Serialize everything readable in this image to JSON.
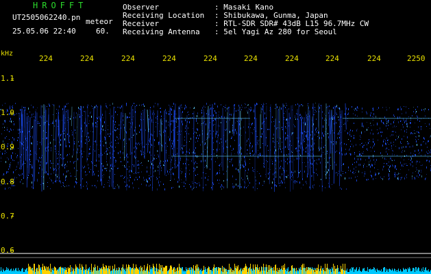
{
  "header": {
    "app_title": "HROFFT",
    "file_name": "UT2505062240.pn",
    "file_tag": "meteor",
    "timestamp": "25.05.06 22:40",
    "rate": "60."
  },
  "station": {
    "observer_label": "Observer",
    "observer_value": ": Masaki Kano",
    "location_label": "Receiving Location",
    "location_value": ": Shibukawa, Gunma, Japan",
    "receiver_label": "Receiver",
    "receiver_value": ": RTL-SDR SDR# 43dB L15 96.7MHz CW",
    "antenna_label": "Receiving Antenna",
    "antenna_value": ": 5el Yagi Az 280 for Seoul"
  },
  "colors": {
    "time_ticks": "#e8e000",
    "app_title": "#2cdc2c",
    "signal": "#1e50ff",
    "signal_hot": "#60d0ff",
    "power_bar": "#ffd200",
    "power_base": "#00c8ff"
  },
  "chart_data": {
    "type": "heatmap",
    "x_tick_labels": [
      "224",
      "224",
      "224",
      "224",
      "224",
      "224",
      "224",
      "224",
      "224",
      "2250"
    ],
    "y_unit": "kHz",
    "y_tick_labels": [
      "1.1",
      "1.0",
      "0.9",
      "0.8",
      "0.7",
      "0.6"
    ],
    "y_ticks": [
      1.1,
      1.0,
      0.9,
      0.8,
      0.7,
      0.6
    ],
    "ylim": [
      0.58,
      1.17
    ],
    "signal_band_khz": [
      0.78,
      1.03
    ],
    "grid": false
  }
}
